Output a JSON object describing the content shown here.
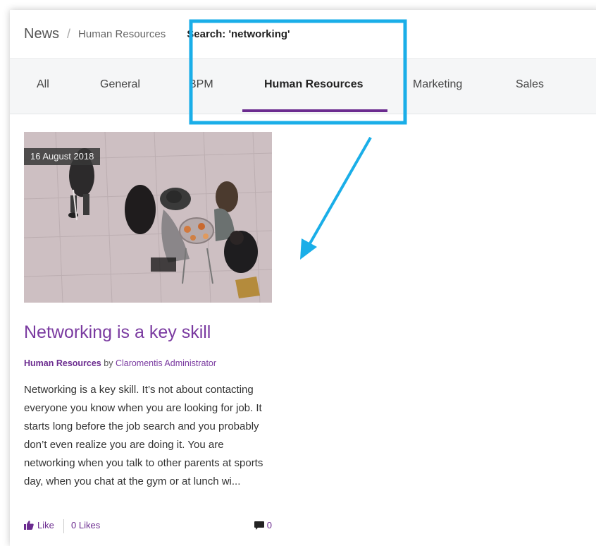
{
  "breadcrumb": {
    "root": "News",
    "separator": "/",
    "category": "Human Resources",
    "search": "Search: 'networking'"
  },
  "tabs": [
    {
      "label": "All"
    },
    {
      "label": "General"
    },
    {
      "label": "BPM"
    },
    {
      "label": "Human Resources",
      "active": true
    },
    {
      "label": "Marketing"
    },
    {
      "label": "Sales"
    }
  ],
  "article": {
    "date": "16 August 2018",
    "title": "Networking is a key skill",
    "category": "Human Resources",
    "by": "by",
    "author": "Claromentis Administrator",
    "excerpt": "Networking is a key skill. It’s not about contacting everyone you know when you are looking for job. It starts long before the job search and you probably don’t even realize you are doing it. You are networking when you talk to other parents at sports day, when you chat at the gym or at lunch wi...",
    "like_label": "Like",
    "likes_count": "0 Likes",
    "comments_count": "0",
    "image_icon": "photo-people-meeting-overhead"
  },
  "colors": {
    "accent": "#6b2b8f",
    "annotation": "#1aaee8",
    "tabs_bg": "#f5f6f7"
  }
}
